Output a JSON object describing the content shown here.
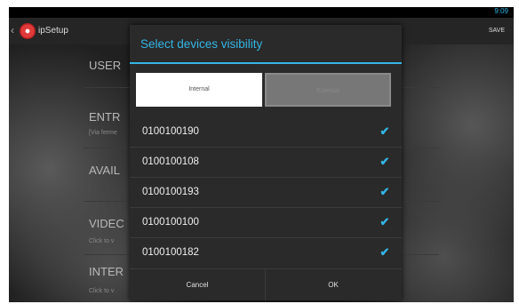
{
  "status_bar": {
    "time": "9:09"
  },
  "action_bar": {
    "title": "ipSetup",
    "save_label": "SAVE"
  },
  "background_list": [
    {
      "heading": "USER",
      "sub": ""
    },
    {
      "heading": "ENTR",
      "sub": "[Via ferme"
    },
    {
      "heading": "AVAIL",
      "sub": ""
    },
    {
      "heading": "VIDEC",
      "sub": "Click to v"
    },
    {
      "heading": "INTER",
      "sub": "Click to v"
    }
  ],
  "dialog": {
    "title": "Select devices visibility",
    "tabs": {
      "internal": "Internal",
      "external": "External",
      "selected": "Internal"
    },
    "devices": [
      {
        "id": "0100100190",
        "checked": true
      },
      {
        "id": "0100100108",
        "checked": true
      },
      {
        "id": "0100100193",
        "checked": true
      },
      {
        "id": "0100100100",
        "checked": true
      },
      {
        "id": "0100100182",
        "checked": true
      }
    ],
    "buttons": {
      "cancel": "Cancel",
      "ok": "OK"
    }
  },
  "colors": {
    "accent": "#33b5e5",
    "dialog_bg": "#2a2a2a"
  }
}
